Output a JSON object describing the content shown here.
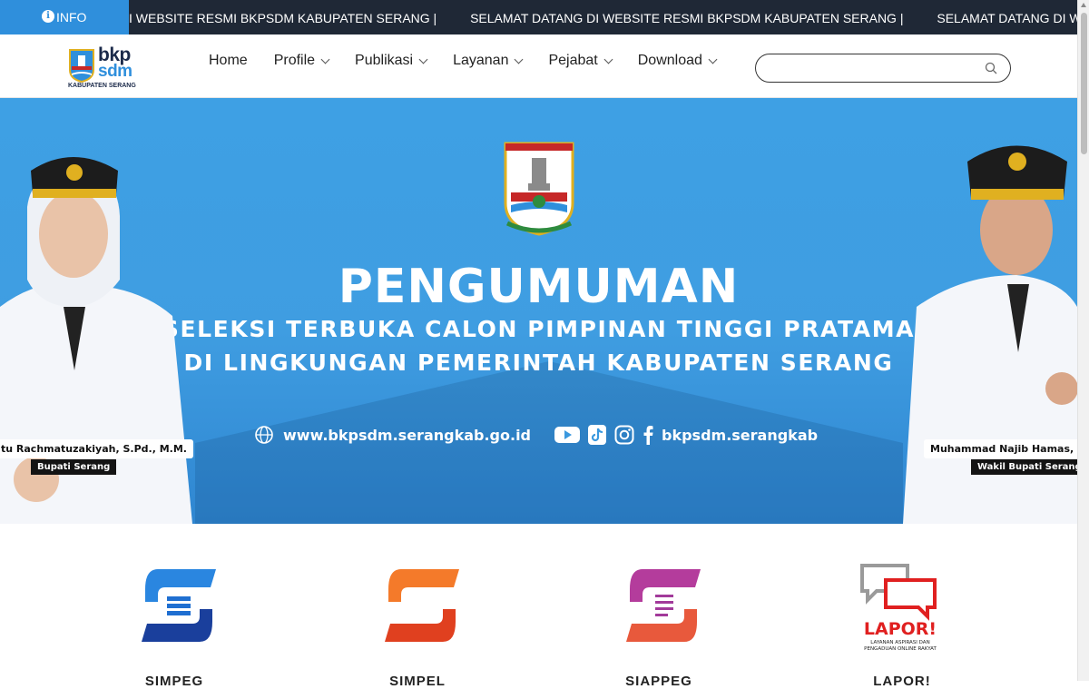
{
  "ticker": {
    "badge_label": "INFO",
    "items": [
      "I WEBSITE RESMI BKPSDM KABUPATEN SERANG   |",
      "SELAMAT DATANG DI WEBSITE RESMI BKPSDM KABUPATEN SERANG   |",
      "SELAMAT DATANG DI WEBSITE RESMI BKPSDM KABUPATEN SERANG"
    ]
  },
  "logo": {
    "line1": "bkp",
    "line2": "sdm",
    "line3": "KABUPATEN SERANG"
  },
  "nav": {
    "items": [
      {
        "label": "Home",
        "has_dropdown": false
      },
      {
        "label": "Profile",
        "has_dropdown": true
      },
      {
        "label": "Publikasi",
        "has_dropdown": true
      },
      {
        "label": "Layanan",
        "has_dropdown": true
      },
      {
        "label": "Pejabat",
        "has_dropdown": true
      },
      {
        "label": "Download",
        "has_dropdown": true
      }
    ]
  },
  "search": {
    "value": "",
    "placeholder": "",
    "icon": "search-icon"
  },
  "hero": {
    "title": "PENGUMUMAN",
    "subtitle_line1": "SELEKSI TERBUKA CALON PIMPINAN TINGGI PRATAMA",
    "subtitle_line2": "DI LINGKUNGAN PEMERINTAH KABUPATEN SERANG",
    "website": "www.bkpsdm.serangkab.go.id",
    "social_handle": "bkpsdm.serangkab",
    "social_icons": [
      "youtube-icon",
      "tiktok-icon",
      "instagram-icon",
      "facebook-icon"
    ],
    "left_person": {
      "name": "tu Rachmatuzakiyah, S.Pd., M.M.",
      "role": "Bupati Serang"
    },
    "right_person": {
      "name": "Muhammad Najib Hamas, S.",
      "role": "Wakil Bupati Serang"
    },
    "background_color": "#3ea0e4"
  },
  "services": [
    {
      "label": "SIMPEG",
      "icon": "simpeg-icon",
      "color": "#1f6fd1"
    },
    {
      "label": "SIMPEL",
      "icon": "simpel-icon",
      "color": "#f05a28"
    },
    {
      "label": "SIAPPEG",
      "icon": "siappeg-icon",
      "color": "#a23a9a"
    },
    {
      "label": "LAPOR!",
      "icon": "lapor-icon",
      "color": "#e02020"
    }
  ],
  "colors": {
    "ticker_bg": "#1f2836",
    "badge_bg": "#2f8fdc",
    "brand_blue": "#2f8fdc",
    "brand_navy": "#1b2a4a"
  }
}
